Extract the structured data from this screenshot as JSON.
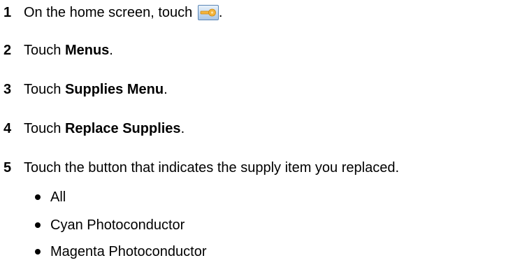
{
  "steps": [
    {
      "number": "1",
      "prefix": "On the home screen, touch",
      "bold": "",
      "suffix": "."
    },
    {
      "number": "2",
      "prefix": "Touch ",
      "bold": "Menus",
      "suffix": "."
    },
    {
      "number": "3",
      "prefix": "Touch ",
      "bold": "Supplies Menu",
      "suffix": "."
    },
    {
      "number": "4",
      "prefix": "Touch ",
      "bold": "Replace Supplies",
      "suffix": "."
    },
    {
      "number": "5",
      "prefix": "Touch the button that indicates the supply item you replaced.",
      "bold": "",
      "suffix": ""
    }
  ],
  "supply_items": [
    "All",
    "Cyan Photoconductor",
    "Magenta Photoconductor"
  ],
  "icons": {
    "settings_key": "key-icon"
  },
  "colors": {
    "key_fill": "#f4b33a",
    "button_border": "#5a86b6"
  }
}
